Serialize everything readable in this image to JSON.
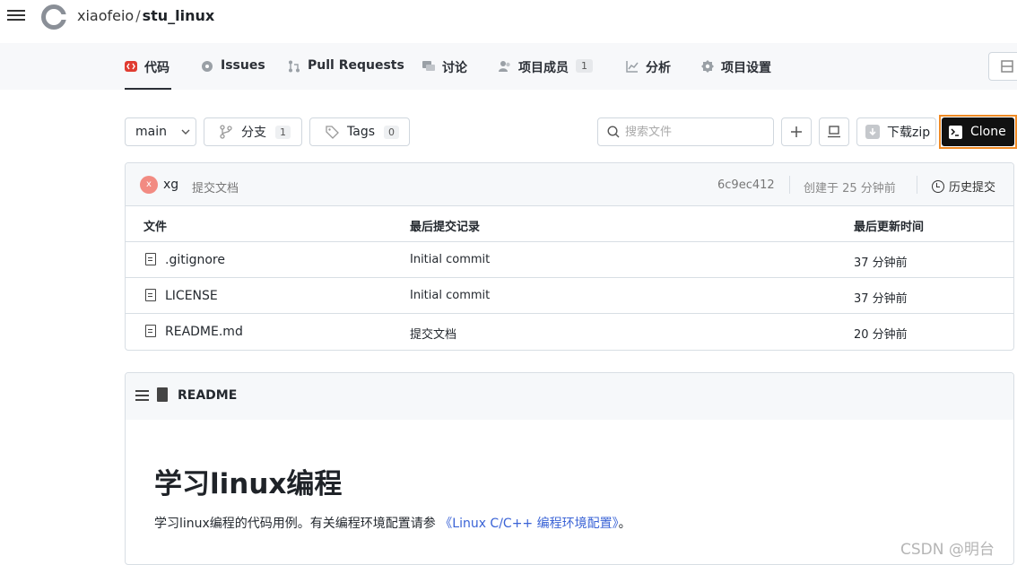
{
  "header": {
    "owner": "xiaofeio",
    "separator": "/",
    "repo": "stu_linux"
  },
  "tabs": [
    {
      "label": "代码",
      "icon": "code-icon",
      "active": true
    },
    {
      "label": "Issues",
      "icon": "issue-icon"
    },
    {
      "label": "Pull Requests",
      "icon": "pull-request-icon"
    },
    {
      "label": "讨论",
      "icon": "discussion-icon"
    },
    {
      "label": "项目成员",
      "icon": "members-icon",
      "count": "1"
    },
    {
      "label": "分析",
      "icon": "chart-icon"
    },
    {
      "label": "项目设置",
      "icon": "gear-icon"
    }
  ],
  "toolbar": {
    "branch": "main",
    "branches_label": "分支",
    "branches_count": "1",
    "tags_label": "Tags",
    "tags_count": "0",
    "search_placeholder": "搜索文件",
    "download_label": "下载zip",
    "clone_label": "Clone"
  },
  "commit": {
    "avatar_letter": "x",
    "author": "xg",
    "message": "提交文档",
    "sha": "6c9ec412",
    "time": "创建于 25 分钟前",
    "history_label": "历史提交"
  },
  "files": {
    "headers": [
      "文件",
      "最后提交记录",
      "最后更新时间"
    ],
    "rows": [
      {
        "name": ".gitignore",
        "commit": "Initial commit",
        "time": "37 分钟前"
      },
      {
        "name": "LICENSE",
        "commit": "Initial commit",
        "time": "37 分钟前"
      },
      {
        "name": "README.md",
        "commit": "提交文档",
        "time": "20 分钟前"
      }
    ]
  },
  "readme": {
    "header": "README",
    "title": "学习linux编程",
    "text_before": "学习linux编程的代码用例。有关编程环境配置请参 ",
    "link": "《Linux C/C++ 编程环境配置》",
    "text_after": "。"
  },
  "watermark": "CSDN @明台"
}
